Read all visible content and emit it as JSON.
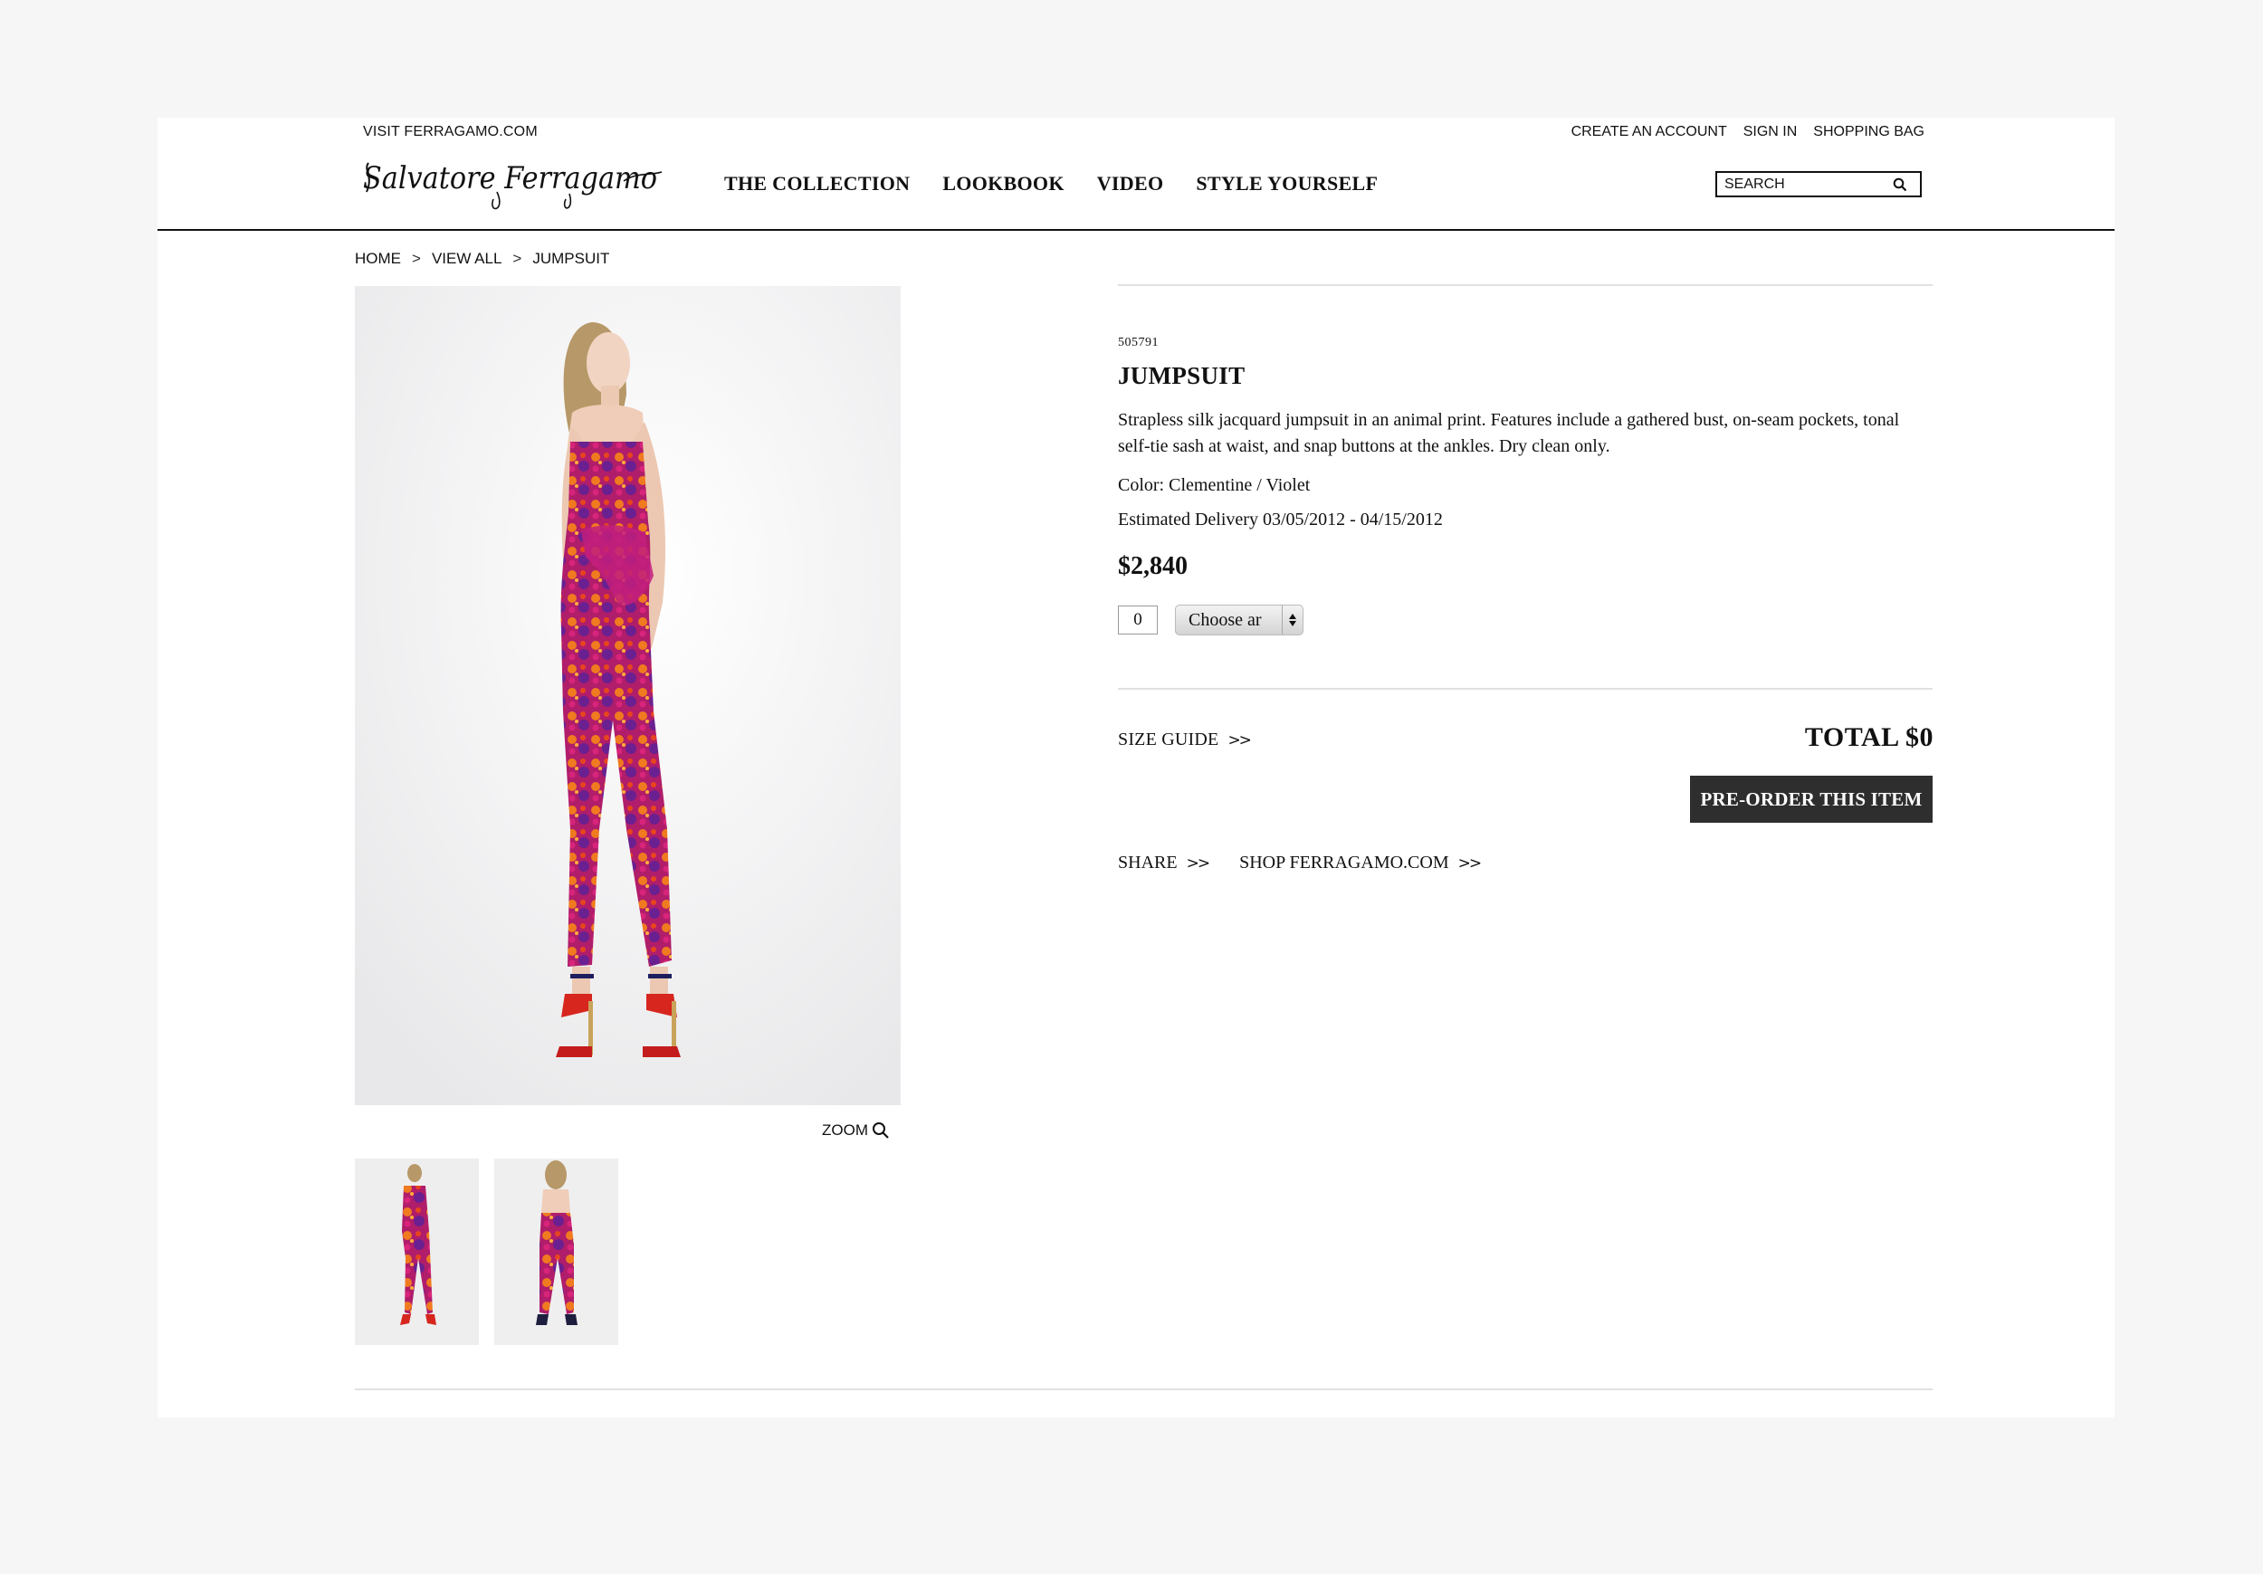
{
  "header": {
    "visit_link": "VISIT FERRAGAMO.COM",
    "logo_text": "Salvatore Ferragamo",
    "utility_links": [
      "CREATE AN ACCOUNT",
      "SIGN IN",
      "SHOPPING BAG"
    ],
    "nav": [
      "THE COLLECTION",
      "LOOKBOOK",
      "VIDEO",
      "STYLE YOURSELF"
    ],
    "search_placeholder": "SEARCH"
  },
  "breadcrumb": {
    "items": [
      "HOME",
      "VIEW ALL",
      "JUMPSUIT"
    ],
    "separator": ">"
  },
  "gallery": {
    "zoom_label": "ZOOM",
    "thumbnail_count": 2
  },
  "product": {
    "sku": "505791",
    "name": "JUMPSUIT",
    "description": "Strapless silk jacquard jumpsuit in an animal print. Features include a gathered bust, on-seam pockets, tonal self-tie sash at waist, and snap buttons at the ankles. Dry clean only.",
    "color": "Color: Clementine / Violet",
    "delivery": "Estimated Delivery 03/05/2012 - 04/15/2012",
    "price": "$2,840",
    "quantity": "0",
    "size_select": "Choose ar",
    "size_guide": "SIZE GUIDE",
    "total": "TOTAL $0",
    "preorder_button": "PRE-ORDER THIS ITEM",
    "share": "SHARE",
    "shop_link": "SHOP FERRAGAMO.COM"
  },
  "colors": {
    "button_bg": "#2e2e2e",
    "rule": "#e1e1e1",
    "print_magenta": "#b01d6a",
    "print_orange": "#f07a1f",
    "print_violet": "#6a2090"
  }
}
